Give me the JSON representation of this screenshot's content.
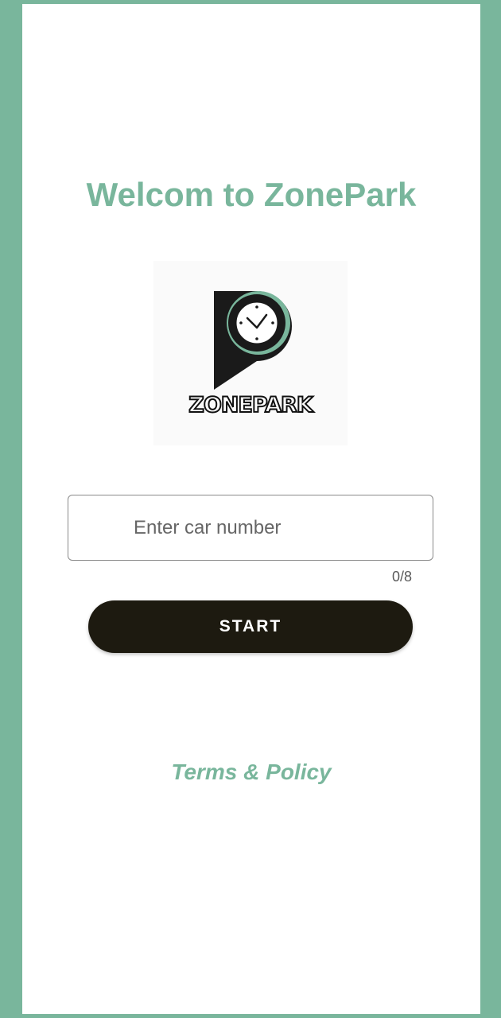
{
  "header": {
    "title": "Welcom to ZonePark"
  },
  "logo": {
    "icon": "parking-clock-pin-icon",
    "wordmark": "ZONEPARK"
  },
  "form": {
    "car_number_placeholder": "Enter car number",
    "car_number_value": "",
    "char_counter": "0/8",
    "start_label": "START"
  },
  "footer": {
    "terms_label": "Terms & Policy"
  },
  "colors": {
    "accent": "#79b69c",
    "button": "#1d1a10",
    "background": "#ffffff"
  }
}
